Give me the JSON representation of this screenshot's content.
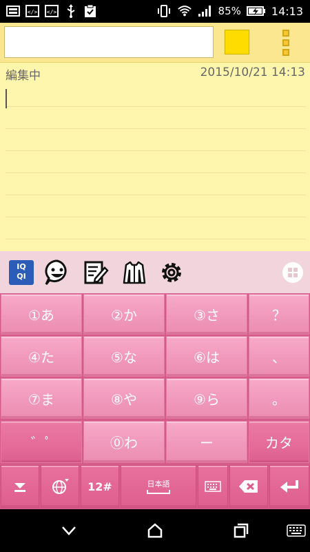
{
  "status_bar": {
    "battery": "85%",
    "time": "14:13"
  },
  "memo": {
    "title_value": "",
    "status": "編集中",
    "date": "2015/10/21 14:13",
    "body_value": "",
    "color": "#ffdc00"
  },
  "ime_toolbar": {
    "logo_text_line1": "IQ",
    "logo_text_line2": "QI"
  },
  "keyboard": {
    "row1": [
      "①あ",
      "②か",
      "③さ",
      "？"
    ],
    "row2": [
      "④た",
      "⑤な",
      "⑥は",
      "、"
    ],
    "row3": [
      "⑦ま",
      "⑧や",
      "⑨ら",
      "。"
    ],
    "row4": [
      "゛ﾟ",
      "⓪わ",
      "ー",
      "カタ"
    ],
    "func": {
      "num_label": "12#",
      "lang_label": "日本語"
    }
  },
  "colors": {
    "key_pink": "#f19abd",
    "memo_yellow": "#fff6ae",
    "toolbar_pink": "#f2d5dc"
  }
}
